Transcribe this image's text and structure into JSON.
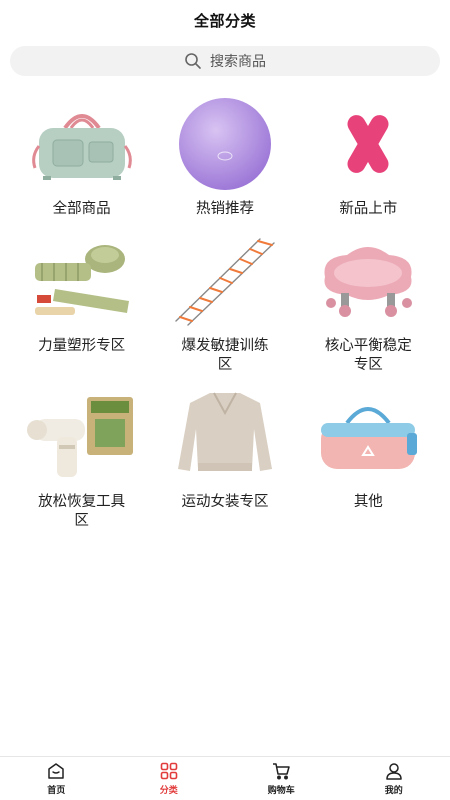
{
  "header": {
    "title": "全部分类"
  },
  "search": {
    "placeholder": "搜索商品"
  },
  "categories": [
    {
      "label": "全部商品",
      "icon": "duffel-bag-icon"
    },
    {
      "label": "热销推荐",
      "icon": "yoga-ball-icon"
    },
    {
      "label": "新品上市",
      "icon": "kinesiology-tape-icon"
    },
    {
      "label": "力量塑形专区",
      "icon": "ankle-weights-icon"
    },
    {
      "label": "爆发敏捷训练区",
      "icon": "agility-ladder-icon"
    },
    {
      "label": "核心平衡稳定专区",
      "icon": "balance-board-icon"
    },
    {
      "label": "放松恢复工具区",
      "icon": "massage-gun-icon"
    },
    {
      "label": "运动女装专区",
      "icon": "womens-sweater-icon"
    },
    {
      "label": "其他",
      "icon": "gym-bag-icon"
    }
  ],
  "tabbar": {
    "active": "分类",
    "active_color": "#e23b3b",
    "items": [
      {
        "label": "首页",
        "icon": "home-icon"
      },
      {
        "label": "分类",
        "icon": "category-grid-icon"
      },
      {
        "label": "购物车",
        "icon": "cart-icon"
      },
      {
        "label": "我的",
        "icon": "user-icon"
      }
    ]
  }
}
